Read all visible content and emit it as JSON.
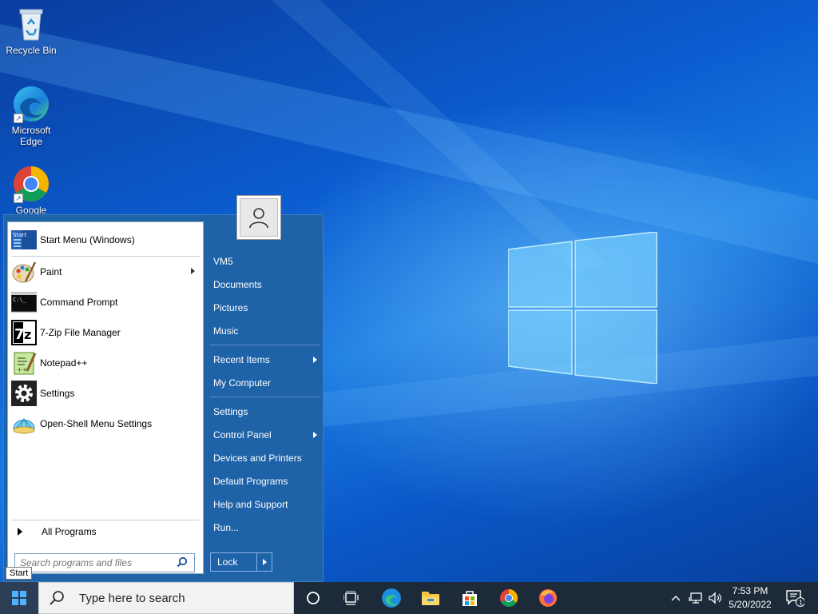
{
  "desktop": {
    "icons": [
      {
        "label": "Recycle Bin",
        "icon": "recycle-bin-icon"
      },
      {
        "label": "Microsoft Edge",
        "icon": "edge-icon"
      },
      {
        "label": "Google",
        "icon": "chrome-icon"
      }
    ]
  },
  "start_menu": {
    "pinned": [
      {
        "label": "Start Menu (Windows)",
        "icon": "start-menu-icon"
      }
    ],
    "programs": [
      {
        "label": "Paint",
        "icon": "paint-icon",
        "has_submenu": true
      },
      {
        "label": "Command Prompt",
        "icon": "command-prompt-icon"
      },
      {
        "label": "7-Zip File Manager",
        "icon": "7zip-icon"
      },
      {
        "label": "Notepad++",
        "icon": "notepadpp-icon"
      },
      {
        "label": "Settings",
        "icon": "gear-icon"
      },
      {
        "label": "Open-Shell Menu Settings",
        "icon": "open-shell-icon"
      }
    ],
    "all_programs": "All Programs",
    "search_placeholder": "Search programs and files",
    "right": {
      "user": "VM5",
      "group1": [
        "Documents",
        "Pictures",
        "Music"
      ],
      "recent_items": "Recent Items",
      "my_computer": "My Computer",
      "settings": "Settings",
      "control_panel": "Control Panel",
      "devices": "Devices and Printers",
      "default_programs": "Default Programs",
      "help": "Help and Support",
      "run": "Run..."
    },
    "lock_label": "Lock"
  },
  "tooltip": "Start",
  "taskbar": {
    "search_placeholder": "Type here to search",
    "time": "7:53 PM",
    "date": "5/20/2022",
    "notification_count": "1",
    "accent": "#1c2a3a"
  }
}
